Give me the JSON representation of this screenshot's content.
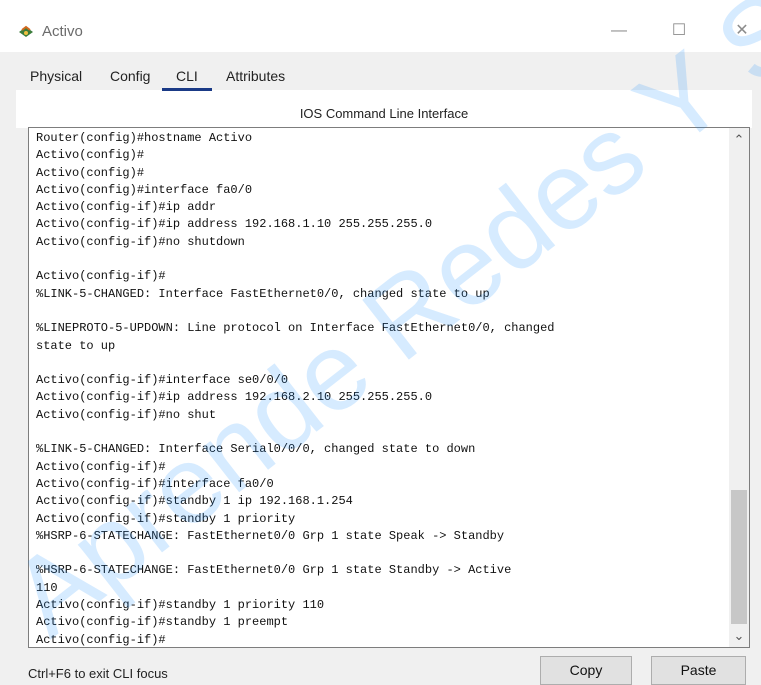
{
  "window": {
    "title": "Activo",
    "minimize": "—",
    "maximize": "☐",
    "close": "✕"
  },
  "tabs": [
    {
      "label": "Physical"
    },
    {
      "label": "Config"
    },
    {
      "label": "CLI"
    },
    {
      "label": "Attributes"
    }
  ],
  "active_tab": "CLI",
  "cli": {
    "header": "IOS Command Line Interface",
    "lines": [
      "Router(config)#hostname Activo",
      "Activo(config)#",
      "Activo(config)#",
      "Activo(config)#interface fa0/0",
      "Activo(config-if)#ip addr",
      "Activo(config-if)#ip address 192.168.1.10 255.255.255.0",
      "Activo(config-if)#no shutdown",
      "",
      "Activo(config-if)#",
      "%LINK-5-CHANGED: Interface FastEthernet0/0, changed state to up",
      "",
      "%LINEPROTO-5-UPDOWN: Line protocol on Interface FastEthernet0/0, changed",
      "state to up",
      "",
      "Activo(config-if)#interface se0/0/0",
      "Activo(config-if)#ip address 192.168.2.10 255.255.255.0",
      "Activo(config-if)#no shut",
      "",
      "%LINK-5-CHANGED: Interface Serial0/0/0, changed state to down",
      "Activo(config-if)#",
      "Activo(config-if)#interface fa0/0",
      "Activo(config-if)#standby 1 ip 192.168.1.254",
      "Activo(config-if)#standby 1 priority",
      "%HSRP-6-STATECHANGE: FastEthernet0/0 Grp 1 state Speak -> Standby",
      "",
      "%HSRP-6-STATECHANGE: FastEthernet0/0 Grp 1 state Standby -> Active",
      "110",
      "Activo(config-if)#standby 1 priority 110",
      "Activo(config-if)#standby 1 preempt",
      "Activo(config-if)#"
    ]
  },
  "footer": {
    "hint": "Ctrl+F6 to exit CLI focus",
    "copy_label": "Copy",
    "paste_label": "Paste"
  },
  "watermark": {
    "text": "Aprende Redes Y Se",
    "color": "#1e90ff"
  }
}
